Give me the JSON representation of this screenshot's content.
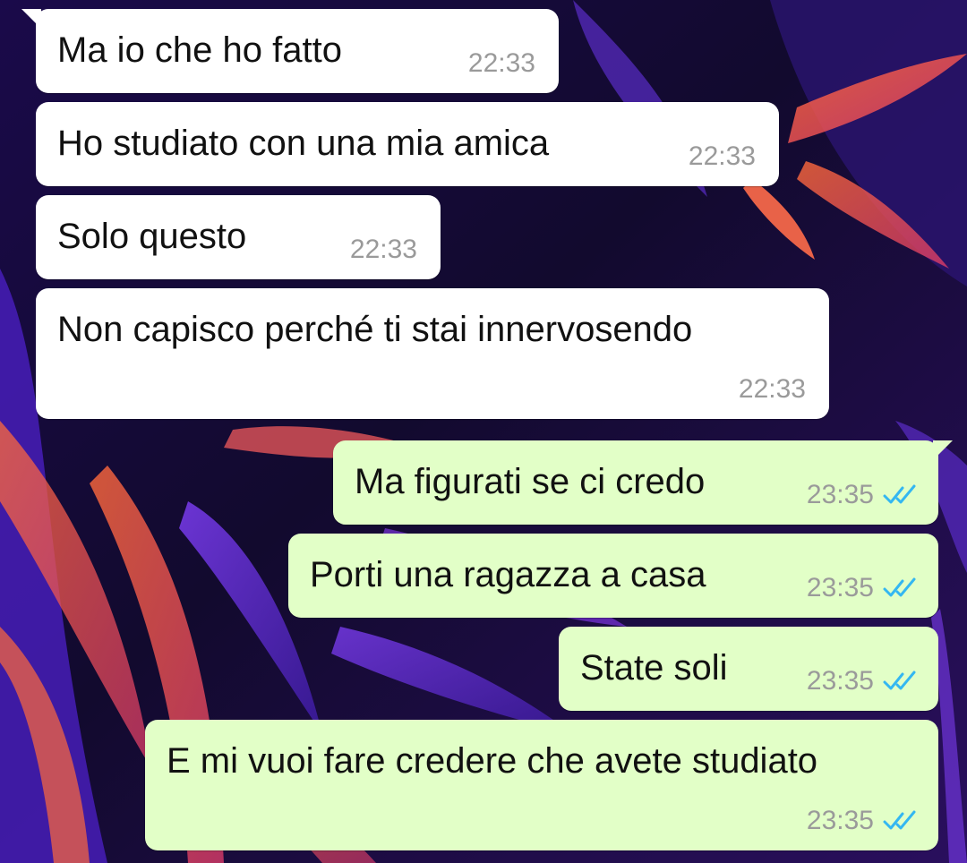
{
  "messages": [
    {
      "direction": "in",
      "text": "Ma io che ho fatto",
      "time": "22:33"
    },
    {
      "direction": "in",
      "text": "Ho studiato con una mia amica",
      "time": "22:33"
    },
    {
      "direction": "in",
      "text": "Solo questo",
      "time": "22:33"
    },
    {
      "direction": "in",
      "text": "Non capisco perché ti stai innervosendo",
      "time": "22:33"
    },
    {
      "direction": "out",
      "text": "Ma figurati se ci credo",
      "time": "23:35",
      "status_icon": "double-check-read-icon"
    },
    {
      "direction": "out",
      "text": "Porti una ragazza a casa",
      "time": "23:35",
      "status_icon": "double-check-read-icon"
    },
    {
      "direction": "out",
      "text": "State soli",
      "time": "23:35",
      "status_icon": "double-check-read-icon"
    },
    {
      "direction": "out",
      "text": "E mi vuoi fare credere che  avete studiato",
      "time": "23:35",
      "status_icon": "double-check-read-icon"
    }
  ],
  "colors": {
    "incoming_bubble": "#ffffff",
    "outgoing_bubble": "#e2ffc7",
    "timestamp": "#9a9a9a",
    "read_ticks": "#34b7f1",
    "wallpaper_base": "#0a0718",
    "wallpaper_accent_purple": "#6a2fd6",
    "wallpaper_accent_orange": "#ff5a3c"
  }
}
